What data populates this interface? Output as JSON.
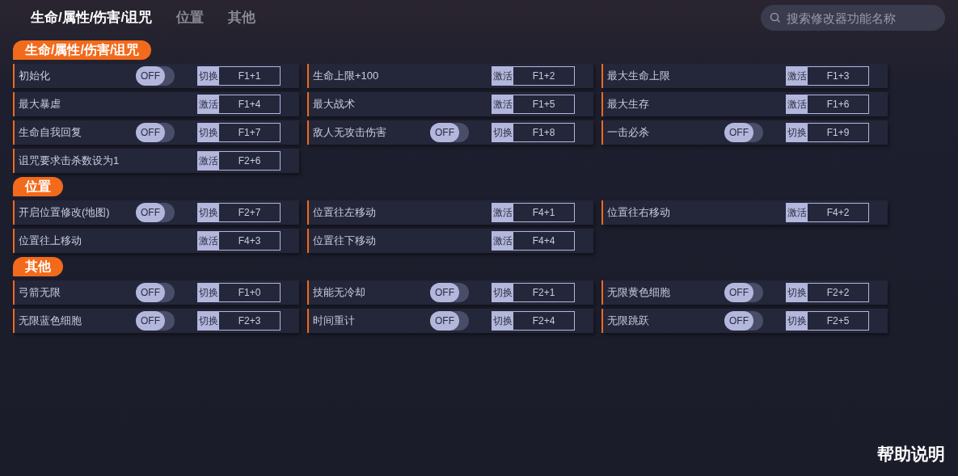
{
  "tabs": [
    {
      "label": "生命/属性/伤害/诅咒",
      "selected": true
    },
    {
      "label": "位置",
      "selected": false
    },
    {
      "label": "其他",
      "selected": false
    }
  ],
  "search": {
    "placeholder": "搜索修改器功能名称"
  },
  "sections": [
    {
      "title": "生命/属性/伤害/诅咒",
      "items": [
        {
          "name": "初始化",
          "kind": "toggle",
          "on": false,
          "switch_label": "OFF",
          "action": "切换",
          "hotkey": "F1+1"
        },
        {
          "name": "生命上限+100",
          "kind": "activate",
          "action": "激活",
          "hotkey": "F1+2"
        },
        {
          "name": "最大生命上限",
          "kind": "activate",
          "action": "激活",
          "hotkey": "F1+3"
        },
        {
          "name": "最大暴虐",
          "kind": "activate",
          "action": "激活",
          "hotkey": "F1+4"
        },
        {
          "name": "最大战术",
          "kind": "activate",
          "action": "激活",
          "hotkey": "F1+5"
        },
        {
          "name": "最大生存",
          "kind": "activate",
          "action": "激活",
          "hotkey": "F1+6"
        },
        {
          "name": "生命自我回复",
          "kind": "toggle",
          "on": false,
          "switch_label": "OFF",
          "action": "切换",
          "hotkey": "F1+7"
        },
        {
          "name": "敌人无攻击伤害",
          "kind": "toggle",
          "on": false,
          "switch_label": "OFF",
          "action": "切换",
          "hotkey": "F1+8"
        },
        {
          "name": "一击必杀",
          "kind": "toggle",
          "on": false,
          "switch_label": "OFF",
          "action": "切换",
          "hotkey": "F1+9"
        },
        {
          "name": "诅咒要求击杀数设为1",
          "kind": "activate",
          "action": "激活",
          "hotkey": "F2+6"
        }
      ]
    },
    {
      "title": "位置",
      "items": [
        {
          "name": "开启位置修改(地图)",
          "kind": "toggle",
          "on": false,
          "switch_label": "OFF",
          "action": "切换",
          "hotkey": "F2+7"
        },
        {
          "name": "位置往左移动",
          "kind": "activate",
          "action": "激活",
          "hotkey": "F4+1"
        },
        {
          "name": "位置往右移动",
          "kind": "activate",
          "action": "激活",
          "hotkey": "F4+2"
        },
        {
          "name": "位置往上移动",
          "kind": "activate",
          "action": "激活",
          "hotkey": "F4+3"
        },
        {
          "name": "位置往下移动",
          "kind": "activate",
          "action": "激活",
          "hotkey": "F4+4"
        }
      ]
    },
    {
      "title": "其他",
      "items": [
        {
          "name": "弓箭无限",
          "kind": "toggle",
          "on": false,
          "switch_label": "OFF",
          "action": "切换",
          "hotkey": "F1+0"
        },
        {
          "name": "技能无冷却",
          "kind": "toggle",
          "on": false,
          "switch_label": "OFF",
          "action": "切换",
          "hotkey": "F2+1"
        },
        {
          "name": "无限黄色细胞",
          "kind": "toggle",
          "on": false,
          "switch_label": "OFF",
          "action": "切换",
          "hotkey": "F2+2"
        },
        {
          "name": "无限蓝色细胞",
          "kind": "toggle",
          "on": false,
          "switch_label": "OFF",
          "action": "切换",
          "hotkey": "F2+3"
        },
        {
          "name": "时间重计",
          "kind": "toggle",
          "on": false,
          "switch_label": "OFF",
          "action": "切换",
          "hotkey": "F2+4"
        },
        {
          "name": "无限跳跃",
          "kind": "toggle",
          "on": false,
          "switch_label": "OFF",
          "action": "切换",
          "hotkey": "F2+5"
        }
      ]
    }
  ],
  "help": "帮助说明"
}
